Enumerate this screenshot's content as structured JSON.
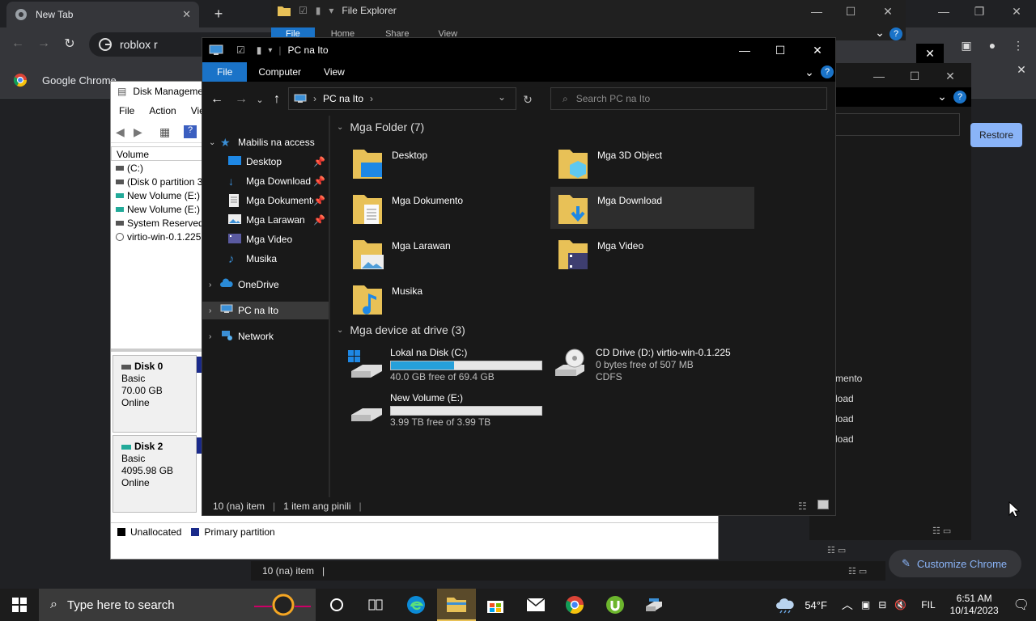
{
  "chrome": {
    "tab_title": "New Tab",
    "omnibox_text": "roblox r",
    "bookmark_label": "Google Chrome",
    "customize_label": "Customize Chrome",
    "restore_label": "Restore"
  },
  "fe_back": {
    "title": "File Explorer",
    "tabs": [
      "File",
      "Home",
      "Share",
      "View"
    ],
    "status": "10 (na) item"
  },
  "disk_mgmt": {
    "title": "Disk Manageme",
    "menu": [
      "File",
      "Action",
      "Vie"
    ],
    "column": "Volume",
    "volumes": [
      "(C:)",
      "(Disk 0 partition 3",
      "New Volume (E:)",
      "New Volume (E:)",
      "System Reserved",
      "virtio-win-0.1.225"
    ],
    "disks": [
      {
        "name": "Disk 0",
        "type": "Basic",
        "size": "70.00 GB",
        "status": "Online"
      },
      {
        "name": "Disk 2",
        "type": "Basic",
        "size": "4095.98 GB",
        "status": "Online"
      }
    ],
    "legend": [
      "Unallocated",
      "Primary partition"
    ]
  },
  "right_window": {
    "items": [
      "mento",
      "load",
      "load",
      "load"
    ]
  },
  "explorer": {
    "title": "PC na Ito",
    "ribbon_tabs": [
      "File",
      "Computer",
      "View"
    ],
    "address": "PC na Ito",
    "search_placeholder": "Search PC na Ito",
    "nav": {
      "quick_access": "Mabilis na access",
      "pinned": [
        "Desktop",
        "Mga Download",
        "Mga Dokumento",
        "Mga Larawan"
      ],
      "unpinned": [
        "Mga Video",
        "Musika"
      ],
      "onedrive": "OneDrive",
      "this_pc": "PC na Ito",
      "network": "Network"
    },
    "folders_header": "Mga Folder (7)",
    "folders": [
      "Desktop",
      "Mga 3D Object",
      "Mga Dokumento",
      "Mga Download",
      "Mga Larawan",
      "Mga Video",
      "Musika"
    ],
    "devices_header": "Mga device at drive (3)",
    "drives": [
      {
        "name": "Lokal na Disk (C:)",
        "free": "40.0 GB free of 69.4 GB",
        "used_fraction": 0.42
      },
      {
        "name": "New Volume (E:)",
        "free": "3.99 TB free of 3.99 TB",
        "used_fraction": 0.0
      }
    ],
    "cd_drive": {
      "name": "CD Drive (D:) virtio-win-0.1.225",
      "free": "0 bytes free of 507 MB",
      "fs": "CDFS"
    },
    "status_count": "10 (na) item",
    "status_selected": "1 item ang pinili"
  },
  "taskbar": {
    "search_placeholder": "Type here to search",
    "weather": "54°F",
    "lang": "FIL",
    "time": "6:51 AM",
    "date": "10/14/2023"
  }
}
